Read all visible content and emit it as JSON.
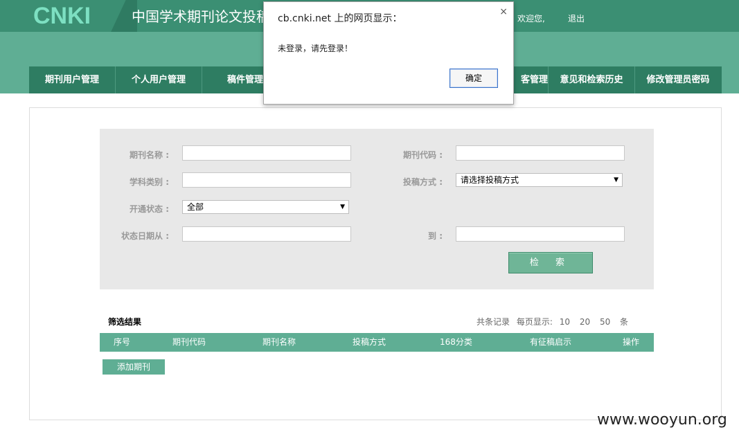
{
  "header": {
    "logo_text": "CNKI",
    "system_title": "中国学术期刊论文投稿",
    "welcome": "欢迎您,",
    "logout": "退出"
  },
  "nav": {
    "items": [
      {
        "label": "期刊用户管理"
      },
      {
        "label": "个人用户管理"
      },
      {
        "label": "稿件管理"
      },
      {
        "label": ""
      },
      {
        "label": ""
      },
      {
        "label": "客管理"
      },
      {
        "label": "意见和检索历史"
      },
      {
        "label": "修改管理员密码"
      }
    ]
  },
  "search": {
    "journal_name_label": "期刊名称 :",
    "journal_code_label": "期刊代码 :",
    "subject_label": "学科类别 :",
    "submit_method_label": "投稿方式 :",
    "submit_method_value": "请选择投稿方式",
    "status_label": "开通状态 :",
    "status_value": "全部",
    "date_from_label": "状态日期从 :",
    "date_to_label": "到 :",
    "search_button": "检 索"
  },
  "results": {
    "title": "筛选结果",
    "total_label": "共条记录",
    "per_page_label": "每页显示:",
    "page_sizes": [
      "10",
      "20",
      "50"
    ],
    "unit": "条",
    "columns": [
      "序号",
      "期刊代码",
      "期刊名称",
      "投稿方式",
      "168分类",
      "有征稿启示",
      "操作"
    ],
    "add_button": "添加期刊"
  },
  "dialog": {
    "title": "cb.cnki.net 上的网页显示：",
    "close": "×",
    "message": "未登录，请先登录！",
    "ok_button": "确定"
  },
  "watermark": "www.wooyun.org",
  "colors": {
    "header_dark": "#3b8f73",
    "header_band": "#5fae94",
    "nav_bg": "#2e7d62",
    "accent": "#5fae94"
  }
}
